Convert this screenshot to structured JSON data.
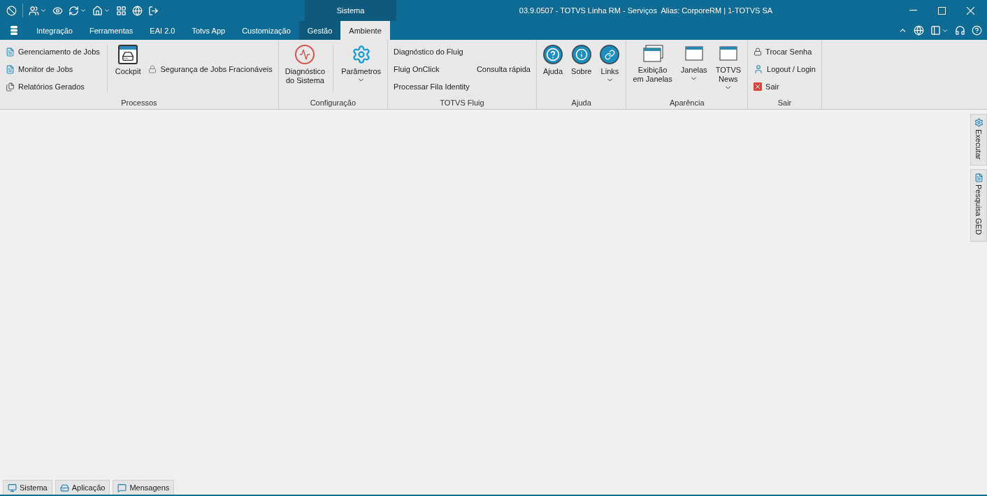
{
  "title_bar": {
    "context_tab": "Sistema",
    "title": "03.9.0507 - TOTVS Linha RM - Serviços  Alias: CorporeRM | 1-TOTVS SA"
  },
  "menu_tabs": [
    {
      "label": "Integração",
      "selected": false,
      "contextual": false
    },
    {
      "label": "Ferramentas",
      "selected": false,
      "contextual": false
    },
    {
      "label": "EAI 2.0",
      "selected": false,
      "contextual": false
    },
    {
      "label": "Totvs App",
      "selected": false,
      "contextual": false
    },
    {
      "label": "Customização",
      "selected": false,
      "contextual": false
    },
    {
      "label": "Gestão",
      "selected": false,
      "contextual": true
    },
    {
      "label": "Ambiente",
      "selected": true,
      "contextual": true
    }
  ],
  "ribbon_groups": [
    {
      "label": "Processos",
      "columns": [
        {
          "kind": "stack",
          "items": [
            {
              "label": "Gerenciamento de Jobs"
            },
            {
              "label": "Monitor de Jobs"
            },
            {
              "label": "Relatórios Gerados"
            }
          ]
        },
        {
          "kind": "large",
          "divider": true,
          "label": "Cockpit",
          "dropdown": false
        },
        {
          "kind": "stack",
          "items": [
            {
              "label": "Segurança de Jobs Fracionáveis"
            }
          ]
        }
      ]
    },
    {
      "label": "Configuração",
      "columns": [
        {
          "kind": "large",
          "divider": false,
          "label": "Diagnóstico\ndo Sistema",
          "dropdown": false
        },
        {
          "kind": "large",
          "divider": true,
          "label": "Parâmetros",
          "dropdown": true
        }
      ]
    },
    {
      "label": "TOTVS Fluig",
      "columns": [
        {
          "kind": "stack",
          "items": [
            {
              "label": "Diagnóstico do Fluig"
            },
            {
              "label": "Fluig OnClick"
            },
            {
              "label": "Processar Fila Identity"
            }
          ]
        },
        {
          "kind": "stack",
          "items": [
            {
              "label": "Consulta rápida"
            }
          ]
        }
      ]
    },
    {
      "label": "Ajuda",
      "columns": [
        {
          "kind": "large",
          "divider": false,
          "label": "Ajuda",
          "dropdown": false
        },
        {
          "kind": "large",
          "divider": false,
          "label": "Sobre",
          "dropdown": false
        },
        {
          "kind": "large",
          "divider": false,
          "label": "Links",
          "dropdown": true
        }
      ]
    },
    {
      "label": "Aparência",
      "columns": [
        {
          "kind": "large",
          "divider": false,
          "label": "Exibição\nem Janelas",
          "dropdown": false
        },
        {
          "kind": "large",
          "divider": false,
          "label": "Janelas",
          "dropdown": true
        },
        {
          "kind": "large",
          "divider": false,
          "label": "TOTVS\nNews",
          "dropdown": true
        }
      ]
    },
    {
      "label": "Sair",
      "columns": [
        {
          "kind": "stack",
          "items": [
            {
              "label": "Trocar Senha"
            },
            {
              "label": "Logout / Login"
            },
            {
              "label": "Sair"
            }
          ]
        }
      ]
    }
  ],
  "side_tabs": [
    {
      "label": "Executar"
    },
    {
      "label": "Pesquisa GED"
    }
  ],
  "bottom_tabs": [
    {
      "label": "Sistema"
    },
    {
      "label": "Aplicação"
    },
    {
      "label": "Mensagens"
    }
  ]
}
